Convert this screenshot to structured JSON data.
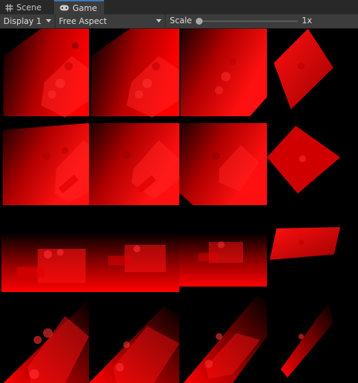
{
  "tabs": [
    {
      "label": "Scene",
      "icon": "grid-icon"
    },
    {
      "label": "Game",
      "icon": "gamepad-icon"
    }
  ],
  "toolbar": {
    "display": "Display 1",
    "aspect": "Free Aspect",
    "scale_label": "Scale",
    "scale_value": "1x",
    "scale_fraction": 0.0
  },
  "colors": {
    "accent": "#3a79bb",
    "red": "#ff0000",
    "bg": "#000000"
  }
}
